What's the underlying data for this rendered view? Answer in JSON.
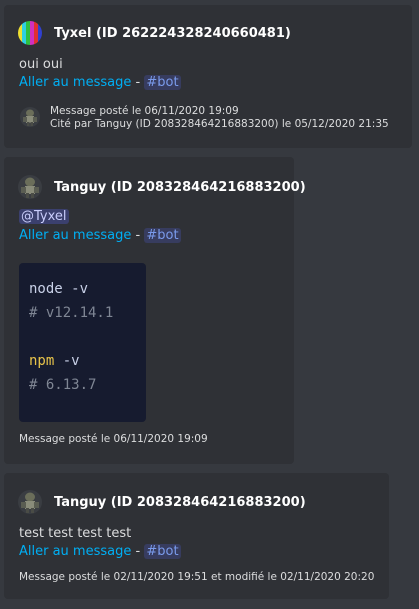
{
  "messages": [
    {
      "author": "Tyxel (ID 262224328240660481)",
      "content": "oui oui",
      "jump_link": "Aller au message",
      "separator": "-",
      "channel": "#bot",
      "footer_line1": "Message posté le 06/11/2020 19:09",
      "footer_line2": "Cité par Tanguy (ID 208328464216883200) le 05/12/2020 21:35"
    },
    {
      "author": "Tanguy (ID 208328464216883200)",
      "mention": "@Tyxel",
      "jump_link": "Aller au message",
      "separator": "-",
      "channel": "#bot",
      "code": {
        "line1_cmd": "node",
        "line1_flag": " -v",
        "line2": "# v12.14.1",
        "line3_cmd": "npm",
        "line3_flag": " -v",
        "line4": "# 6.13.7"
      },
      "footer": "Message posté le 06/11/2020 19:09"
    },
    {
      "author": "Tanguy (ID 208328464216883200)",
      "content": "test test test test",
      "jump_link": "Aller au message",
      "separator": "-",
      "channel": "#bot",
      "footer": "Message posté le 02/11/2020 19:51 et modifié le 02/11/2020 20:20"
    }
  ]
}
